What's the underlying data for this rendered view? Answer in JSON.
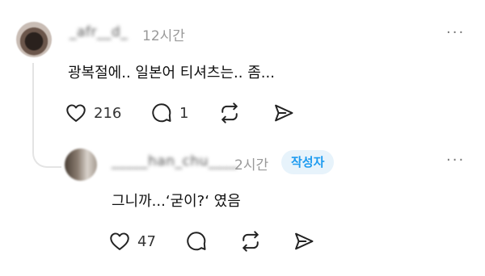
{
  "post": {
    "username": "_afr__d_",
    "time": "12시간",
    "more": "···",
    "text": "광복절에.. 일본어 티셔츠는.. 좀...",
    "likes": "216",
    "comments": "1"
  },
  "reply": {
    "username": "_____han_chu____",
    "time": "2시간",
    "author_badge": "작성자",
    "more": "···",
    "text": "그니까...‘굳이?‘ 였음",
    "likes": "47"
  },
  "icons": {
    "like": "heart-icon",
    "comment": "comment-bubble-icon",
    "repost": "repost-icon",
    "share": "send-icon",
    "more": "more-dots-icon"
  },
  "colors": {
    "badge_text": "#1d9bf0",
    "badge_bg": "#e7f3fb",
    "meta": "#999999",
    "thread_line": "#e4e4e4"
  }
}
